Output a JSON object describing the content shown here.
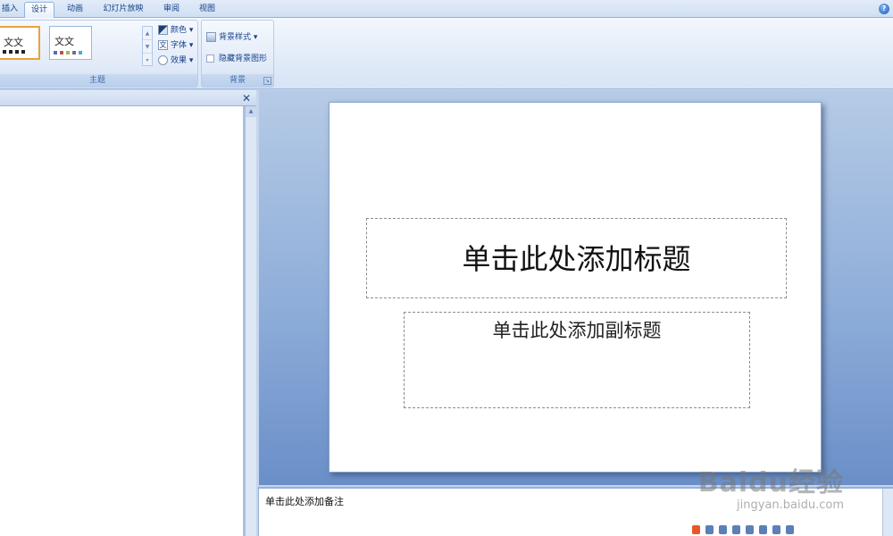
{
  "tabs": [
    {
      "label": "插入",
      "active": false
    },
    {
      "label": "设计",
      "active": true
    },
    {
      "label": "动画",
      "active": false
    },
    {
      "label": "幻灯片放映",
      "active": false
    },
    {
      "label": "审阅",
      "active": false
    },
    {
      "label": "视图",
      "active": false
    }
  ],
  "help_icon": "help-icon",
  "ribbon": {
    "themes_group": {
      "label": "主题",
      "thumb_text": "文文",
      "colors_label": "颜色",
      "fonts_label": "字体",
      "effects_label": "效果"
    },
    "background_group": {
      "label": "背景",
      "styles_label": "背景样式",
      "hide_bg_label": "隐藏背景图形"
    }
  },
  "slide": {
    "title_placeholder": "单击此处添加标题",
    "subtitle_placeholder": "单击此处添加副标题"
  },
  "notes": {
    "placeholder": "单击此处添加备注"
  },
  "watermark": {
    "brand": "Baidu经验",
    "url": "jingyan.baidu.com"
  },
  "colors": {
    "accent_selected": "#e8a33d",
    "ribbon_text": "#15428b"
  }
}
